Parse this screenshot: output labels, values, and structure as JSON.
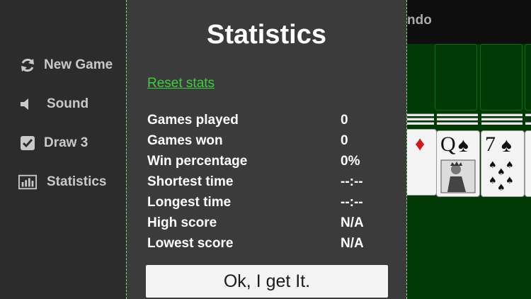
{
  "sidebar": {
    "items": [
      {
        "label": "New Game",
        "icon": "refresh-icon"
      },
      {
        "label": "Sound",
        "icon": "speaker-icon"
      },
      {
        "label": "Draw 3",
        "icon": "checkbox-checked-icon"
      },
      {
        "label": "Statistics",
        "icon": "bar-chart-icon"
      }
    ]
  },
  "game": {
    "title_fragment": "ndo",
    "cards": [
      {
        "rank": "",
        "suit": "♦",
        "color": "#d11a1a"
      },
      {
        "rank": "Q",
        "suit": "♠",
        "color": "#111111"
      },
      {
        "rank": "7",
        "suit": "♠",
        "color": "#111111"
      }
    ]
  },
  "dialog": {
    "title": "Statistics",
    "reset_label": "Reset stats",
    "stats": [
      {
        "label": "Games played",
        "value": "0"
      },
      {
        "label": "Games won",
        "value": "0"
      },
      {
        "label": "Win percentage",
        "value": "0%"
      },
      {
        "label": "Shortest time",
        "value": "--:--"
      },
      {
        "label": "Longest time",
        "value": "--:--"
      },
      {
        "label": "High score",
        "value": "N/A"
      },
      {
        "label": "Lowest score",
        "value": "N/A"
      }
    ],
    "ok_label": "Ok, I get It."
  },
  "colors": {
    "link": "#3bd03b",
    "felt": "#013a05",
    "dialog_bg": "#3b3b3b",
    "sidebar_bg": "#2c2c2c"
  }
}
